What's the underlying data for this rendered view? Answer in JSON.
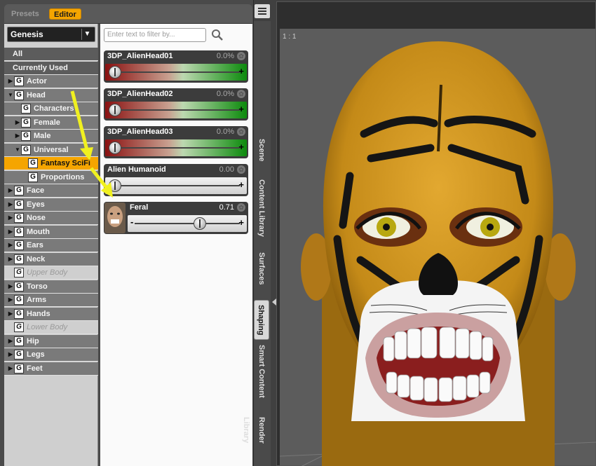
{
  "header": {
    "tab_presets": "Presets",
    "tab_editor": "Editor"
  },
  "tree": {
    "figure": "Genesis",
    "rows": [
      {
        "label": "All",
        "indent": 0,
        "style": "plain",
        "tri": "",
        "g": false
      },
      {
        "label": "Currently Used",
        "indent": 0,
        "style": "plain",
        "tri": "",
        "g": false
      },
      {
        "label": "Actor",
        "indent": 0,
        "style": "",
        "tri": "▶",
        "g": true
      },
      {
        "label": "Head",
        "indent": 0,
        "style": "",
        "tri": "▼",
        "g": true
      },
      {
        "label": "Characters",
        "indent": 1,
        "style": "",
        "tri": "",
        "g": true
      },
      {
        "label": "Female",
        "indent": 1,
        "style": "",
        "tri": "▶",
        "g": true
      },
      {
        "label": "Male",
        "indent": 1,
        "style": "",
        "tri": "▶",
        "g": true
      },
      {
        "label": "Universal",
        "indent": 1,
        "style": "",
        "tri": "▼",
        "g": true
      },
      {
        "label": "Fantasy SciFi",
        "indent": 2,
        "style": "sel",
        "tri": "",
        "g": true
      },
      {
        "label": "Proportions",
        "indent": 2,
        "style": "",
        "tri": "",
        "g": true
      },
      {
        "label": "Face",
        "indent": 0,
        "style": "",
        "tri": "▶",
        "g": true
      },
      {
        "label": "Eyes",
        "indent": 0,
        "style": "",
        "tri": "▶",
        "g": true
      },
      {
        "label": "Nose",
        "indent": 0,
        "style": "",
        "tri": "▶",
        "g": true
      },
      {
        "label": "Mouth",
        "indent": 0,
        "style": "",
        "tri": "▶",
        "g": true
      },
      {
        "label": "Ears",
        "indent": 0,
        "style": "",
        "tri": "▶",
        "g": true
      },
      {
        "label": "Neck",
        "indent": 0,
        "style": "",
        "tri": "▶",
        "g": true
      },
      {
        "label": "Upper Body",
        "indent": 0,
        "style": "dim",
        "tri": "",
        "g": true
      },
      {
        "label": "Torso",
        "indent": 0,
        "style": "",
        "tri": "▶",
        "g": true
      },
      {
        "label": "Arms",
        "indent": 0,
        "style": "",
        "tri": "▶",
        "g": true
      },
      {
        "label": "Hands",
        "indent": 0,
        "style": "",
        "tri": "▶",
        "g": true
      },
      {
        "label": "Lower Body",
        "indent": 0,
        "style": "dim",
        "tri": "",
        "g": true
      },
      {
        "label": "Hip",
        "indent": 0,
        "style": "",
        "tri": "▶",
        "g": true
      },
      {
        "label": "Legs",
        "indent": 0,
        "style": "",
        "tri": "▶",
        "g": true
      },
      {
        "label": "Feet",
        "indent": 0,
        "style": "",
        "tri": "▶",
        "g": true
      }
    ]
  },
  "list": {
    "filter_placeholder": "Enter text to filter by...",
    "morphs": [
      {
        "name": "3DP_AlienHead01",
        "value": "0.0%",
        "style": "grad",
        "level": 0.0
      },
      {
        "name": "3DP_AlienHead02",
        "value": "0.0%",
        "style": "grad",
        "level": 0.0
      },
      {
        "name": "3DP_AlienHead03",
        "value": "0.0%",
        "style": "grad",
        "level": 0.0
      },
      {
        "name": "Alien Humanoid",
        "value": "0.00",
        "style": "grey",
        "level": 0.0
      },
      {
        "name": "Feral",
        "value": "0.71",
        "style": "grey",
        "level": 0.71,
        "thumb": true
      }
    ]
  },
  "side_tabs": [
    "Scene",
    "Content Library",
    "Surfaces",
    "Shaping",
    "Smart Content",
    "Render Library"
  ],
  "active_side_tab": "Shaping",
  "viewport": {
    "zoom_label": "1 : 1"
  },
  "colors": {
    "accent": "#f5a500",
    "panel": "#4a4a4a",
    "skin": "#d8a020"
  }
}
